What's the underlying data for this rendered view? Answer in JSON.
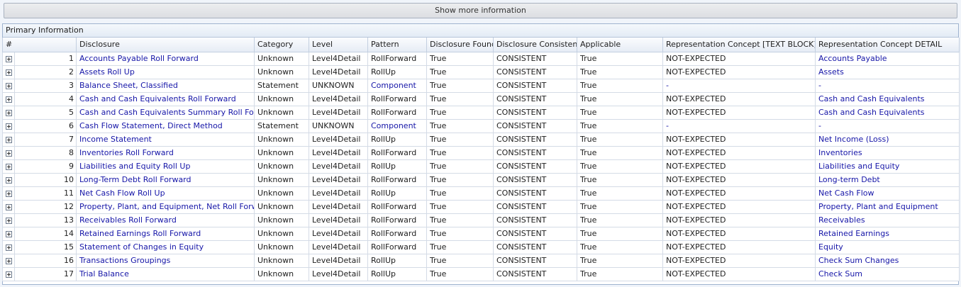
{
  "toolbar": {
    "show_more_label": "Show more information"
  },
  "group": {
    "title": "Primary Information"
  },
  "columns": [
    "#",
    "Disclosure",
    "Category",
    "Level",
    "Pattern",
    "Disclosure Found",
    "Disclosure Consistent",
    "Applicable",
    "Representation Concept [TEXT BLOCK]",
    "Representation Concept DETAIL"
  ],
  "colors": {
    "found_bg": "#b6f0b0",
    "consistent_bg": "#b6f0b0",
    "not_expected_bg": "#d4d4d4",
    "link": "#1616a8"
  },
  "rows": [
    {
      "n": "1",
      "disclosure": "Accounts Payable Roll Forward",
      "category": "Unknown",
      "level": "Level4Detail",
      "pattern": "RollForward",
      "found": "True",
      "consistent": "CONSISTENT",
      "applicable": "True",
      "textblock": "NOT-EXPECTED",
      "detail": "Accounts Payable"
    },
    {
      "n": "2",
      "disclosure": "Assets Roll Up",
      "category": "Unknown",
      "level": "Level4Detail",
      "pattern": "RollUp",
      "found": "True",
      "consistent": "CONSISTENT",
      "applicable": "True",
      "textblock": "NOT-EXPECTED",
      "detail": "Assets"
    },
    {
      "n": "3",
      "disclosure": "Balance Sheet, Classified",
      "category": "Statement",
      "level": "UNKNOWN",
      "pattern": "Component",
      "found": "True",
      "consistent": "CONSISTENT",
      "applicable": "True",
      "textblock": "-",
      "detail": "-"
    },
    {
      "n": "4",
      "disclosure": "Cash and Cash Equivalents Roll Forward",
      "category": "Unknown",
      "level": "Level4Detail",
      "pattern": "RollForward",
      "found": "True",
      "consistent": "CONSISTENT",
      "applicable": "True",
      "textblock": "NOT-EXPECTED",
      "detail": "Cash and Cash Equivalents"
    },
    {
      "n": "5",
      "disclosure": "Cash and Cash Equivalents Summary Roll Forward",
      "category": "Unknown",
      "level": "Level4Detail",
      "pattern": "RollForward",
      "found": "True",
      "consistent": "CONSISTENT",
      "applicable": "True",
      "textblock": "NOT-EXPECTED",
      "detail": "Cash and Cash Equivalents"
    },
    {
      "n": "6",
      "disclosure": "Cash Flow Statement, Direct Method",
      "category": "Statement",
      "level": "UNKNOWN",
      "pattern": "Component",
      "found": "True",
      "consistent": "CONSISTENT",
      "applicable": "True",
      "textblock": "-",
      "detail": "-"
    },
    {
      "n": "7",
      "disclosure": "Income Statement",
      "category": "Unknown",
      "level": "Level4Detail",
      "pattern": "RollUp",
      "found": "True",
      "consistent": "CONSISTENT",
      "applicable": "True",
      "textblock": "NOT-EXPECTED",
      "detail": "Net Income (Loss)"
    },
    {
      "n": "8",
      "disclosure": "Inventories Roll Forward",
      "category": "Unknown",
      "level": "Level4Detail",
      "pattern": "RollForward",
      "found": "True",
      "consistent": "CONSISTENT",
      "applicable": "True",
      "textblock": "NOT-EXPECTED",
      "detail": "Inventories"
    },
    {
      "n": "9",
      "disclosure": "Liabilities and Equity Roll Up",
      "category": "Unknown",
      "level": "Level4Detail",
      "pattern": "RollUp",
      "found": "True",
      "consistent": "CONSISTENT",
      "applicable": "True",
      "textblock": "NOT-EXPECTED",
      "detail": "Liabilities and Equity"
    },
    {
      "n": "10",
      "disclosure": "Long-Term Debt Roll Forward",
      "category": "Unknown",
      "level": "Level4Detail",
      "pattern": "RollForward",
      "found": "True",
      "consistent": "CONSISTENT",
      "applicable": "True",
      "textblock": "NOT-EXPECTED",
      "detail": "Long-term Debt"
    },
    {
      "n": "11",
      "disclosure": "Net Cash Flow Roll Up",
      "category": "Unknown",
      "level": "Level4Detail",
      "pattern": "RollUp",
      "found": "True",
      "consistent": "CONSISTENT",
      "applicable": "True",
      "textblock": "NOT-EXPECTED",
      "detail": "Net Cash Flow"
    },
    {
      "n": "12",
      "disclosure": "Property, Plant, and Equipment, Net Roll Forward",
      "category": "Unknown",
      "level": "Level4Detail",
      "pattern": "RollForward",
      "found": "True",
      "consistent": "CONSISTENT",
      "applicable": "True",
      "textblock": "NOT-EXPECTED",
      "detail": "Property, Plant and Equipment"
    },
    {
      "n": "13",
      "disclosure": "Receivables Roll Forward",
      "category": "Unknown",
      "level": "Level4Detail",
      "pattern": "RollForward",
      "found": "True",
      "consistent": "CONSISTENT",
      "applicable": "True",
      "textblock": "NOT-EXPECTED",
      "detail": "Receivables"
    },
    {
      "n": "14",
      "disclosure": "Retained Earnings Roll Forward",
      "category": "Unknown",
      "level": "Level4Detail",
      "pattern": "RollForward",
      "found": "True",
      "consistent": "CONSISTENT",
      "applicable": "True",
      "textblock": "NOT-EXPECTED",
      "detail": "Retained Earnings"
    },
    {
      "n": "15",
      "disclosure": "Statement of Changes in Equity",
      "category": "Unknown",
      "level": "Level4Detail",
      "pattern": "RollForward",
      "found": "True",
      "consistent": "CONSISTENT",
      "applicable": "True",
      "textblock": "NOT-EXPECTED",
      "detail": "Equity"
    },
    {
      "n": "16",
      "disclosure": "Transactions Groupings",
      "category": "Unknown",
      "level": "Level4Detail",
      "pattern": "RollUp",
      "found": "True",
      "consistent": "CONSISTENT",
      "applicable": "True",
      "textblock": "NOT-EXPECTED",
      "detail": "Check Sum Changes"
    },
    {
      "n": "17",
      "disclosure": "Trial Balance",
      "category": "Unknown",
      "level": "Level4Detail",
      "pattern": "RollUp",
      "found": "True",
      "consistent": "CONSISTENT",
      "applicable": "True",
      "textblock": "NOT-EXPECTED",
      "detail": "Check Sum"
    }
  ]
}
